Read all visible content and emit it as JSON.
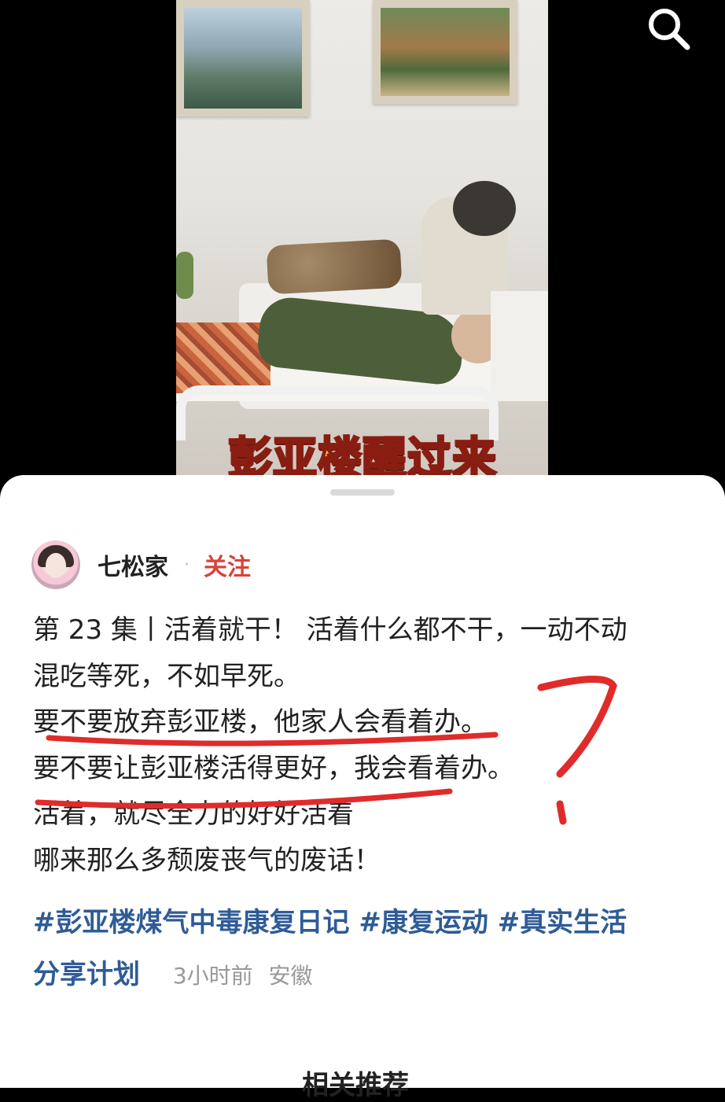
{
  "video": {
    "caption": "彭亚楼醒过来"
  },
  "top_bar": {
    "search_icon": "search-icon"
  },
  "author": {
    "name": "七松家",
    "separator": "·",
    "follow_label": "关注"
  },
  "post": {
    "lines": [
      "第 23 集丨活着就干！ 活着什么都不干，一动不动",
      "混吃等死，不如早死。",
      "要不要放弃彭亚楼，他家人会看着办。",
      "要不要让彭亚楼活得更好，我会看着办。",
      "活着，就尽全力的好好活着",
      "哪来那么多颓废丧气的废话！"
    ],
    "tags": [
      "#彭亚楼煤气中毒康复日记",
      "#康复运动",
      "#真实生活",
      "分享计划"
    ],
    "time": "3小时前",
    "location": "安徽"
  },
  "related": {
    "title": "相关推荐"
  },
  "colors": {
    "follow": "#d7433c",
    "tag": "#2f5b97",
    "annotation": "#e02b2b",
    "meta": "#999999"
  }
}
